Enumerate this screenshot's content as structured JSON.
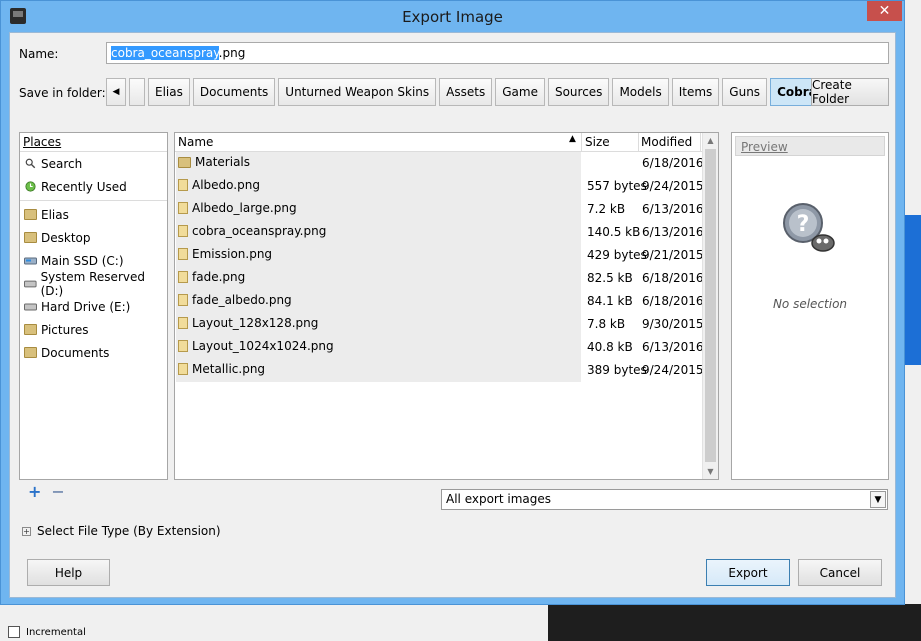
{
  "window": {
    "title": "Export Image",
    "close_glyph": "✕"
  },
  "name_row": {
    "label": "Name:",
    "value_selected": "cobra_oceanspray",
    "value_ext": ".png"
  },
  "folder_row": {
    "label": "Save in folder:",
    "crumbs": [
      "Elias",
      "Documents",
      "Unturned Weapon Skins",
      "Assets",
      "Game",
      "Sources",
      "Models",
      "Items",
      "Guns",
      "Cobra"
    ],
    "active_crumb": "Cobra",
    "create_folder_label": "Create Folder"
  },
  "places": {
    "header": "Places",
    "items": [
      {
        "label": "Search",
        "icon": "search-icon"
      },
      {
        "label": "Recently Used",
        "icon": "clock-icon"
      },
      {
        "label": "Elias",
        "icon": "folder-icon"
      },
      {
        "label": "Desktop",
        "icon": "folder-icon"
      },
      {
        "label": "Main SSD (C:)",
        "icon": "drive-icon"
      },
      {
        "label": "System Reserved (D:)",
        "icon": "drive-icon"
      },
      {
        "label": "Hard Drive (E:)",
        "icon": "drive-icon"
      },
      {
        "label": "Pictures",
        "icon": "folder-icon"
      },
      {
        "label": "Documents",
        "icon": "folder-icon"
      }
    ],
    "add_glyph": "+",
    "remove_glyph": "−"
  },
  "files": {
    "headers": {
      "name": "Name",
      "size": "Size",
      "modified": "Modified"
    },
    "sort_glyph": "▲",
    "rows": [
      {
        "name": "Materials",
        "size": "",
        "modified": "6/18/2016",
        "type": "folder"
      },
      {
        "name": "Albedo.png",
        "size": "557 bytes",
        "modified": "9/24/2015",
        "type": "file"
      },
      {
        "name": "Albedo_large.png",
        "size": "7.2 kB",
        "modified": "6/13/2016",
        "type": "file"
      },
      {
        "name": "cobra_oceanspray.png",
        "size": "140.5 kB",
        "modified": "6/13/2016",
        "type": "file"
      },
      {
        "name": "Emission.png",
        "size": "429 bytes",
        "modified": "9/21/2015",
        "type": "file"
      },
      {
        "name": "fade.png",
        "size": "82.5 kB",
        "modified": "6/18/2016",
        "type": "file"
      },
      {
        "name": "fade_albedo.png",
        "size": "84.1 kB",
        "modified": "6/18/2016",
        "type": "file"
      },
      {
        "name": "Layout_128x128.png",
        "size": "7.8 kB",
        "modified": "9/30/2015",
        "type": "file"
      },
      {
        "name": "Layout_1024x1024.png",
        "size": "40.8 kB",
        "modified": "6/13/2016",
        "type": "file"
      },
      {
        "name": "Metallic.png",
        "size": "389 bytes",
        "modified": "9/24/2015",
        "type": "file"
      }
    ]
  },
  "preview": {
    "header": "Preview",
    "empty_text": "No selection"
  },
  "filter": {
    "value": "All export images"
  },
  "file_type": {
    "label": "Select File Type (By Extension)",
    "expander_glyph": "+"
  },
  "buttons": {
    "help": "Help",
    "export": "Export",
    "cancel": "Cancel"
  },
  "background": {
    "checkbox_label": "Incremental"
  },
  "colors": {
    "accent": "#3399ff",
    "titlebar": "#6fb5f0",
    "close": "#c7504c",
    "active_crumb": "#cde6f7"
  }
}
